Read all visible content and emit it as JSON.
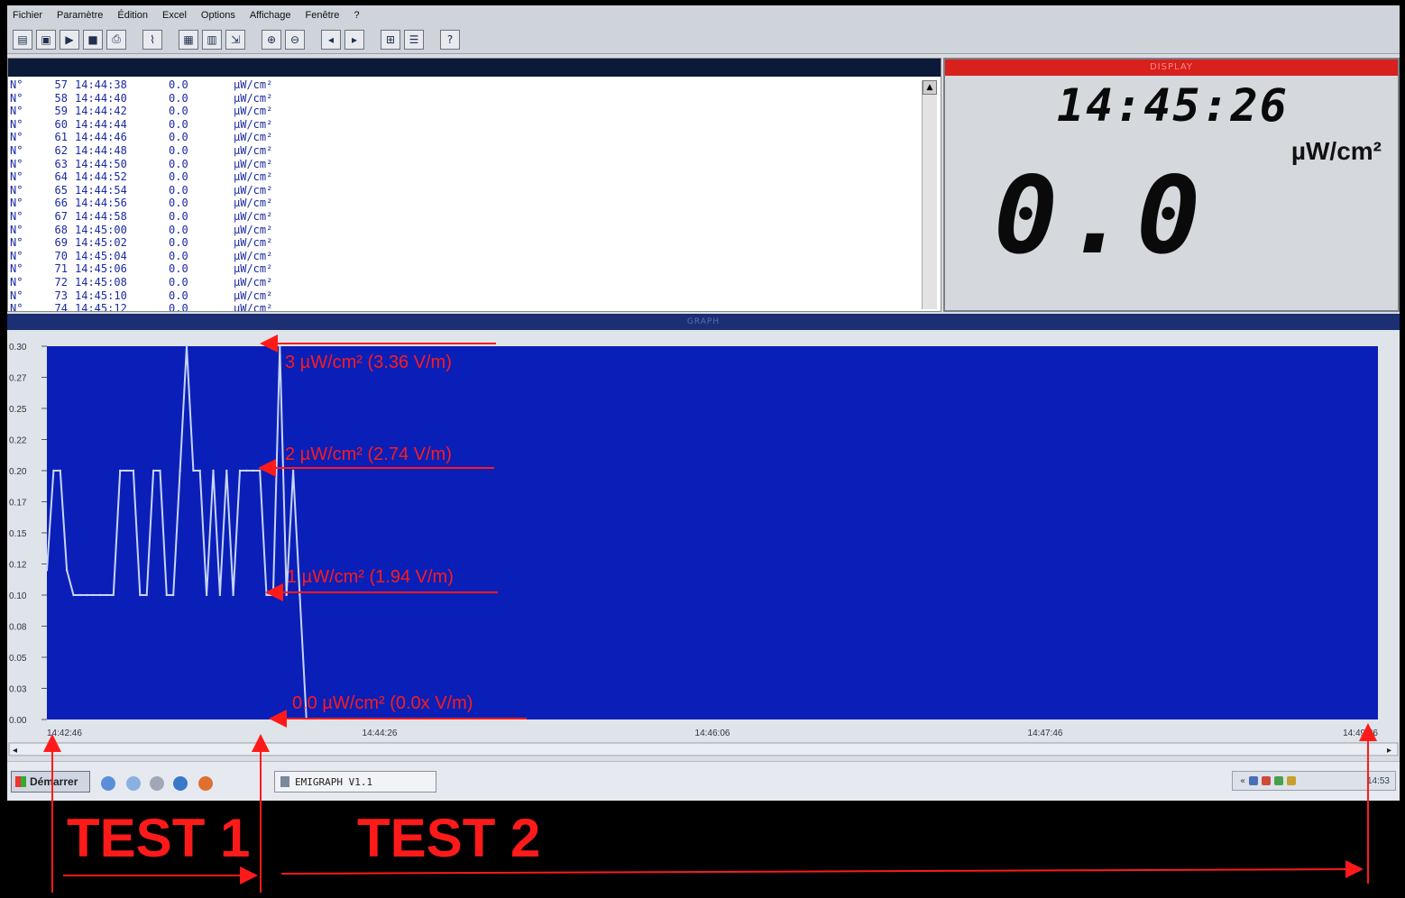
{
  "menu": {
    "items": [
      "Fichier",
      "Paramètre",
      "Édition",
      "Excel",
      "Options",
      "Affichage",
      "Fenêtre",
      "?"
    ]
  },
  "toolbar": {
    "buttons": [
      "open-icon",
      "save-icon",
      "play-icon",
      "stop-icon",
      "print-icon",
      "chart-icon",
      "table-icon",
      "grid-icon",
      "export-icon",
      "zoom-in-icon",
      "zoom-out-icon",
      "prev-icon",
      "next-icon",
      "window-icon",
      "layout-icon",
      "help-icon"
    ]
  },
  "log": {
    "rows": [
      {
        "prefix": "N°",
        "n": "57",
        "time": "14:44:38",
        "value": "0.0",
        "unit": "µW/cm²"
      },
      {
        "prefix": "N°",
        "n": "58",
        "time": "14:44:40",
        "value": "0.0",
        "unit": "µW/cm²"
      },
      {
        "prefix": "N°",
        "n": "59",
        "time": "14:44:42",
        "value": "0.0",
        "unit": "µW/cm²"
      },
      {
        "prefix": "N°",
        "n": "60",
        "time": "14:44:44",
        "value": "0.0",
        "unit": "µW/cm²"
      },
      {
        "prefix": "N°",
        "n": "61",
        "time": "14:44:46",
        "value": "0.0",
        "unit": "µW/cm²"
      },
      {
        "prefix": "N°",
        "n": "62",
        "time": "14:44:48",
        "value": "0.0",
        "unit": "µW/cm²"
      },
      {
        "prefix": "N°",
        "n": "63",
        "time": "14:44:50",
        "value": "0.0",
        "unit": "µW/cm²"
      },
      {
        "prefix": "N°",
        "n": "64",
        "time": "14:44:52",
        "value": "0.0",
        "unit": "µW/cm²"
      },
      {
        "prefix": "N°",
        "n": "65",
        "time": "14:44:54",
        "value": "0.0",
        "unit": "µW/cm²"
      },
      {
        "prefix": "N°",
        "n": "66",
        "time": "14:44:56",
        "value": "0.0",
        "unit": "µW/cm²"
      },
      {
        "prefix": "N°",
        "n": "67",
        "time": "14:44:58",
        "value": "0.0",
        "unit": "µW/cm²"
      },
      {
        "prefix": "N°",
        "n": "68",
        "time": "14:45:00",
        "value": "0.0",
        "unit": "µW/cm²"
      },
      {
        "prefix": "N°",
        "n": "69",
        "time": "14:45:02",
        "value": "0.0",
        "unit": "µW/cm²"
      },
      {
        "prefix": "N°",
        "n": "70",
        "time": "14:45:04",
        "value": "0.0",
        "unit": "µW/cm²"
      },
      {
        "prefix": "N°",
        "n": "71",
        "time": "14:45:06",
        "value": "0.0",
        "unit": "µW/cm²"
      },
      {
        "prefix": "N°",
        "n": "72",
        "time": "14:45:08",
        "value": "0.0",
        "unit": "µW/cm²"
      },
      {
        "prefix": "N°",
        "n": "73",
        "time": "14:45:10",
        "value": "0.0",
        "unit": "µW/cm²"
      },
      {
        "prefix": "N°",
        "n": "74",
        "time": "14:45:12",
        "value": "0.0",
        "unit": "µW/cm²"
      }
    ]
  },
  "display": {
    "title": "DISPLAY",
    "time": "14:45:26",
    "unit": "µW/cm²",
    "value": "0.0"
  },
  "graph": {
    "title": "GRAPH",
    "ylabels": [
      "0.30",
      "0.27",
      "0.25",
      "0.22",
      "0.20",
      "0.17",
      "0.15",
      "0.12",
      "0.10",
      "0.08",
      "0.05",
      "0.03",
      "0.00"
    ],
    "xlabels": [
      "14:42:46",
      "14:44:26",
      "14:46:06",
      "14:47:46",
      "14:49:26"
    ],
    "colors": {
      "plot_bg": "#0a1fb8",
      "trace": "#c8d4f4",
      "annotation": "#ff1a1a"
    }
  },
  "chart_data": {
    "type": "line",
    "ylim": [
      0,
      0.3
    ],
    "x_start": "14:42:46",
    "x_end": "14:49:26",
    "series": [
      {
        "values": [
          0.12,
          0.2,
          0.2,
          0.12,
          0.1,
          0.1,
          0.1,
          0.1,
          0.1,
          0.1,
          0.1,
          0.2,
          0.2,
          0.2,
          0.1,
          0.1,
          0.2,
          0.2,
          0.1,
          0.1,
          0.2,
          0.3,
          0.2,
          0.2,
          0.1,
          0.2,
          0.1,
          0.2,
          0.1,
          0.2,
          0.2,
          0.2,
          0.2,
          0.1,
          0.1,
          0.3,
          0.1,
          0.2,
          0.1,
          0.0,
          0.0
        ]
      }
    ]
  },
  "annotations": {
    "a3": "3 µW/cm²  (3.36 V/m)",
    "a2": "2 µW/cm² (2.74 V/m)",
    "a1": "1 µW/cm² (1.94 V/m)",
    "a0": "0.0 µW/cm²  (0.0x V/m)",
    "test1": "TEST 1",
    "test2": "TEST 2"
  },
  "taskbar": {
    "start_label": "Démarrer",
    "task_label": "EMIGRAPH V1.1",
    "clock": "14:53"
  }
}
